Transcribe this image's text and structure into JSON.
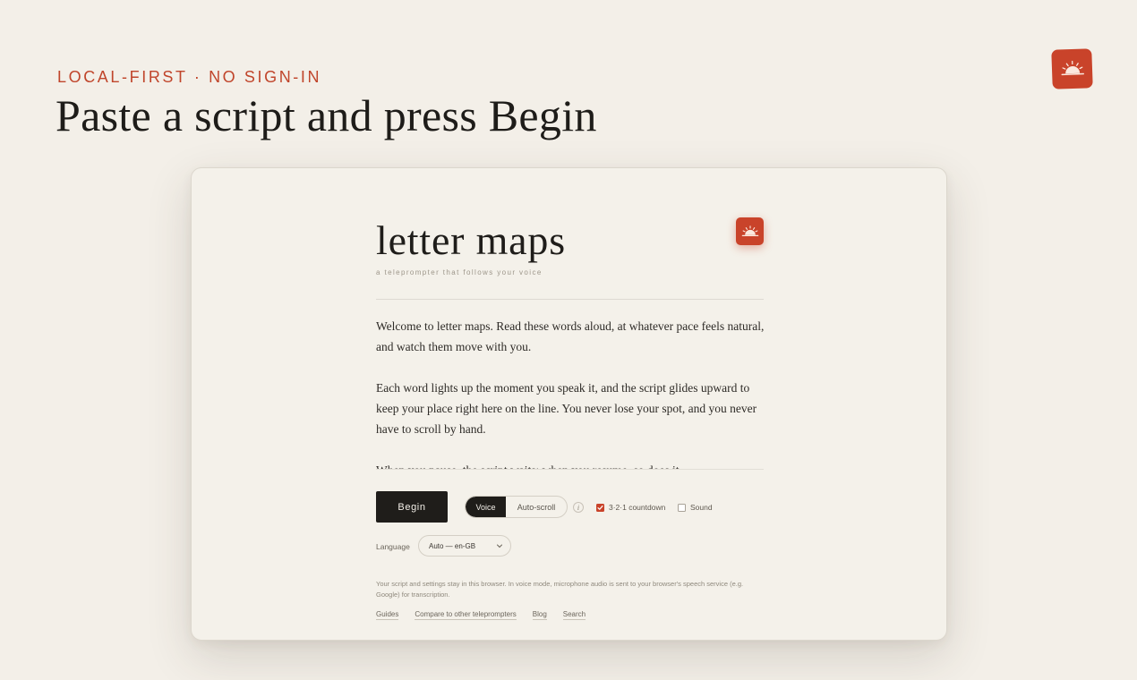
{
  "hero": {
    "eyebrow": "LOCAL-FIRST · NO SIGN-IN",
    "headline": "Paste a script and press Begin",
    "logo_icon": "sunrise-icon",
    "accent_color": "#c9432a"
  },
  "app": {
    "title": "letter maps",
    "tagline": "a teleprompter that follows your voice",
    "logo_icon": "sunrise-icon",
    "script_paragraphs": [
      "Welcome to letter maps. Read these words aloud, at whatever pace feels natural, and watch them move with you.",
      "Each word lights up the moment you speak it, and the script glides upward to keep your place right here on the line. You never lose your spot, and you never have to scroll by hand.",
      "When you pause, the script waits; when you resume, so does it."
    ],
    "controls": {
      "begin_label": "Begin",
      "mode_voice": "Voice",
      "mode_auto": "Auto-scroll",
      "mode_selected": "Voice",
      "info_glyph": "i",
      "countdown_label": "3·2·1 countdown",
      "countdown_checked": true,
      "sound_label": "Sound",
      "sound_checked": false
    },
    "language": {
      "label": "Language",
      "selected": "Auto — en-GB"
    },
    "privacy_note": "Your script and settings stay in this browser. In voice mode, microphone audio is sent to your browser's speech service (e.g. Google) for transcription.",
    "footer_links": [
      "Guides",
      "Compare to other teleprompters",
      "Blog",
      "Search"
    ]
  }
}
